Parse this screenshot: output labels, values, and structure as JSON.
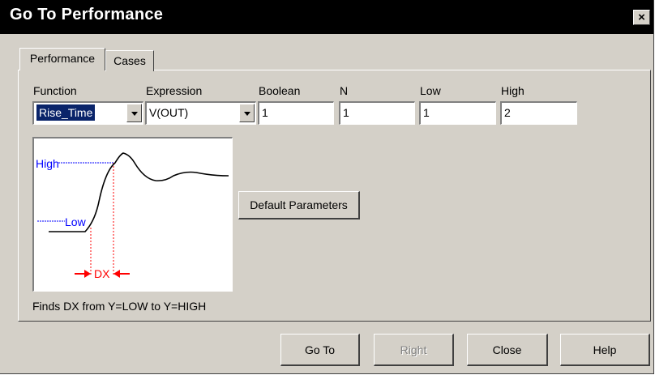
{
  "window": {
    "title": "Go To Performance",
    "close_label": "×"
  },
  "tabs": [
    {
      "label": "Performance",
      "active": true
    },
    {
      "label": "Cases",
      "active": false
    }
  ],
  "fields": {
    "function": {
      "label": "Function",
      "value": "Rise_Time"
    },
    "expression": {
      "label": "Expression",
      "value": "V(OUT)"
    },
    "boolean": {
      "label": "Boolean",
      "value": "1"
    },
    "n": {
      "label": "N",
      "value": "1"
    },
    "low": {
      "label": "Low",
      "value": "1"
    },
    "high": {
      "label": "High",
      "value": "2"
    }
  },
  "diagram": {
    "high_label": "High",
    "low_label": "Low",
    "dx_label": "DX",
    "line_color": "#000000",
    "level_color": "#0000ff",
    "dx_color": "#ff0000"
  },
  "description": "Finds DX from Y=LOW to Y=HIGH",
  "buttons": {
    "default_parameters": "Default Parameters",
    "goto": "Go To",
    "right": "Right",
    "close": "Close",
    "help": "Help"
  }
}
